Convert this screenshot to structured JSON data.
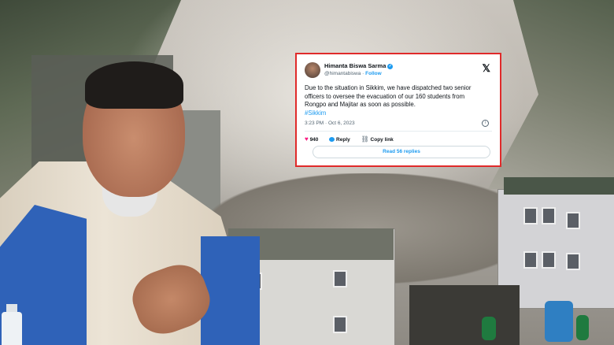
{
  "tweet": {
    "author_name": "Himanta Biswa Sarma",
    "author_handle": "@himantabiswa",
    "follow_label": "Follow",
    "platform_icon": "x-logo-icon",
    "text": "Due to the situation in Sikkim, we have dispatched two senior officers to oversee the evacuation of our 160 students from Rongpo and Majitar as soon as possible.",
    "hashtag": "#Sikkim",
    "timestamp": "3:23 PM · Oct 6, 2023",
    "likes_count": "940",
    "reply_label": "Reply",
    "copy_link_label": "Copy link",
    "read_replies_label": "Read 56 replies",
    "frame_color": "#e02a2a",
    "link_color": "#1d9bf0",
    "like_color": "#f91880"
  }
}
